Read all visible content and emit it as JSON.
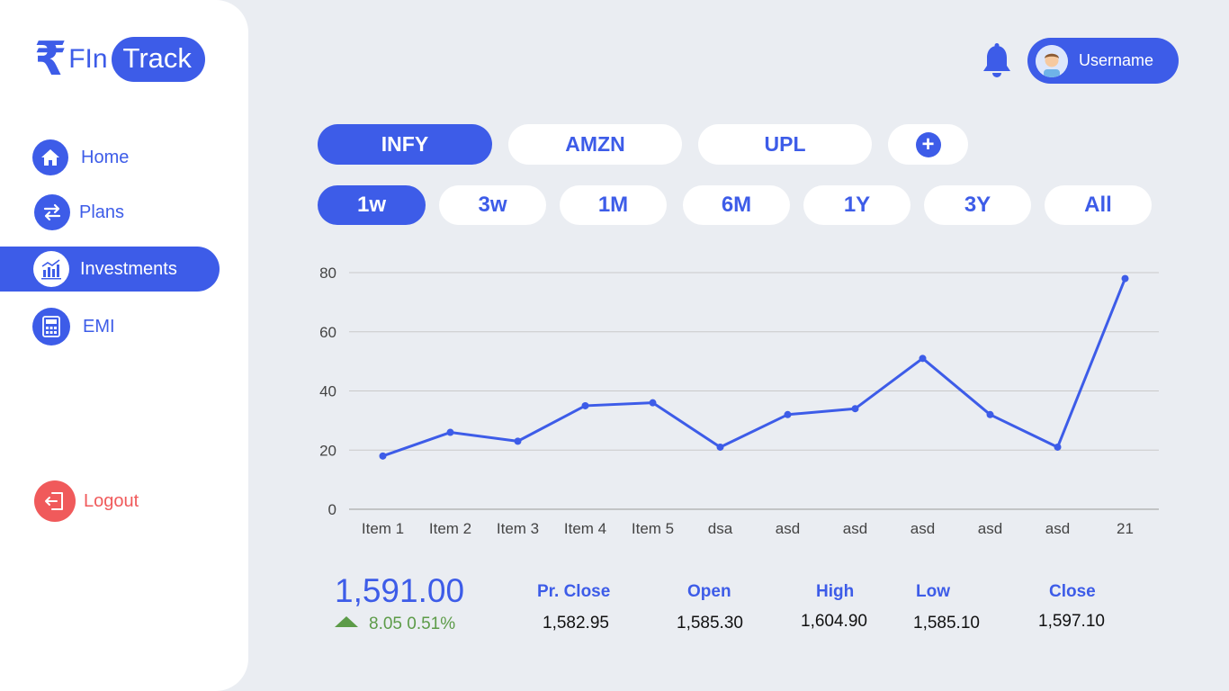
{
  "brand": {
    "symbol": "₹",
    "part1": "FIn",
    "part2": "Track"
  },
  "sidebar": {
    "items": [
      {
        "label": "Home",
        "icon": "home-icon"
      },
      {
        "label": "Plans",
        "icon": "swap-arrows-icon"
      },
      {
        "label": "Investments",
        "icon": "bar-chart-icon",
        "active": true
      },
      {
        "label": "EMI",
        "icon": "calculator-icon"
      }
    ],
    "logout": {
      "label": "Logout",
      "icon": "logout-icon"
    }
  },
  "header": {
    "username": "Username",
    "bell_icon": "bell-icon"
  },
  "tickers": [
    "INFY",
    "AMZN",
    "UPL"
  ],
  "active_ticker": "INFY",
  "ranges": [
    "1w",
    "3w",
    "1M",
    "6M",
    "1Y",
    "3Y",
    "All"
  ],
  "active_range": "1w",
  "colors": {
    "accent": "#3d5ce8",
    "positive": "#5c9b48",
    "logout": "#f05a5b",
    "background": "#eaedf2"
  },
  "chart_data": {
    "type": "line",
    "categories": [
      "Item 1",
      "Item 2",
      "Item 3",
      "Item 4",
      "Item 5",
      "dsa",
      "asd",
      "asd",
      "asd",
      "asd",
      "asd",
      "21"
    ],
    "values": [
      18,
      26,
      23,
      35,
      36,
      21,
      32,
      34,
      51,
      32,
      21,
      78
    ],
    "yticks": [
      0,
      20,
      40,
      60,
      80
    ],
    "ylim": [
      0,
      80
    ],
    "grid": true,
    "color": "#3d5ce8"
  },
  "quote": {
    "price": "1,591.00",
    "change": "8.05 0.51%",
    "stats": [
      {
        "label": "Pr. Close",
        "value": "1,582.95"
      },
      {
        "label": "Open",
        "value": "1,585.30"
      },
      {
        "label": "High",
        "value": "1,604.90"
      },
      {
        "label": "Low",
        "value": "1,585.10"
      },
      {
        "label": "Close",
        "value": "1,597.10"
      }
    ]
  }
}
